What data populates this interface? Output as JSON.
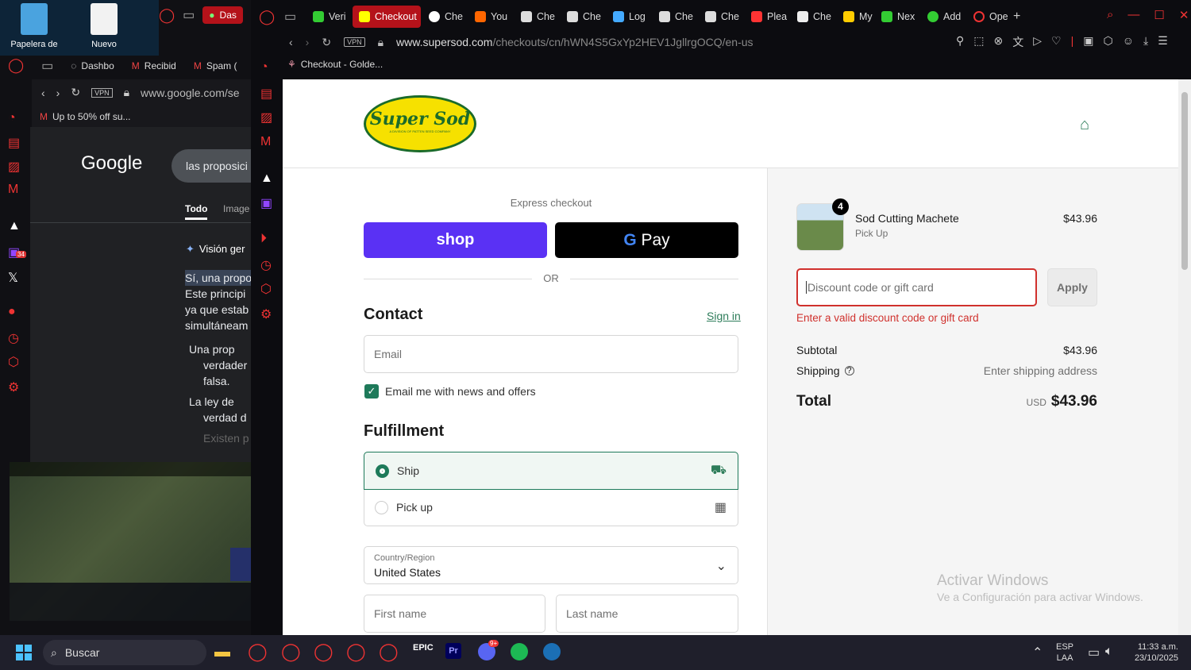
{
  "desktop": {
    "icons": [
      {
        "label": "Papelera de"
      },
      {
        "label": "Nuevo"
      }
    ]
  },
  "back_browser": {
    "tabs": [
      {
        "label": "Das"
      }
    ],
    "bookmarks": [
      {
        "label": "Dashbo"
      },
      {
        "label": "Recibid"
      },
      {
        "label": "Spam ("
      }
    ],
    "url": "www.google.com/se",
    "bookmark_bar": "Up to 50% off su...",
    "google_logo": "Google",
    "search_text": "las proposici",
    "tab_all": "Todo",
    "tab_images": "Image",
    "ai_title": "Visión ger",
    "lines": [
      "Sí, una propo",
      "Este principi",
      "ya que estab",
      "simultáneam"
    ],
    "bullets": [
      "Una prop",
      "verdader",
      "falsa.",
      "La ley de",
      "verdad d",
      "Existen p"
    ],
    "badge": "34"
  },
  "front_browser": {
    "tabs": [
      {
        "label": "Veri"
      },
      {
        "label": "Checkout",
        "active": true
      },
      {
        "label": "Che"
      },
      {
        "label": "You"
      },
      {
        "label": "Che"
      },
      {
        "label": "Che"
      },
      {
        "label": "Log"
      },
      {
        "label": "Che"
      },
      {
        "label": "Che"
      },
      {
        "label": "Plea"
      },
      {
        "label": "Che"
      },
      {
        "label": "My"
      },
      {
        "label": "Nex"
      },
      {
        "label": "Add"
      },
      {
        "label": "Ope"
      }
    ],
    "url_host": "www.supersod.com",
    "url_path": "/checkouts/cn/hWN4S5GxYp2HEV1JgllrgOCQ/en-us",
    "vpn": "VPN",
    "bookmark": "Checkout - Golde..."
  },
  "checkout": {
    "logo_text": "Super Sod",
    "logo_sub": "A DIVISION OF PATTEN SEED COMPANY",
    "express": "Express checkout",
    "shop": "shop",
    "gpay": "Pay",
    "or": "OR",
    "contact": "Contact",
    "signin": "Sign in",
    "email_placeholder": "Email",
    "news": "Email me with news and offers",
    "fulfillment": "Fulfillment",
    "ship": "Ship",
    "pickup": "Pick up",
    "country_label": "Country/Region",
    "country": "United States",
    "first_name": "First name",
    "last_name": "Last name",
    "item": {
      "name": "Sod Cutting Machete",
      "sub": "Pick Up",
      "price": "$43.96",
      "qty": "4"
    },
    "discount_placeholder": "Discount code or gift card",
    "apply": "Apply",
    "error": "Enter a valid discount code or gift card",
    "subtotal_label": "Subtotal",
    "subtotal": "$43.96",
    "shipping_label": "Shipping",
    "shipping": "Enter shipping address",
    "total_label": "Total",
    "currency": "USD",
    "total": "$43.96",
    "watermark1": "Activar Windows",
    "watermark2": "Ve a Configuración para activar Windows."
  },
  "taskbar": {
    "search": "Buscar",
    "lang1": "ESP",
    "lang2": "LAA",
    "time": "11:33 a.m.",
    "date": "23/10/2025",
    "discord_badge": "9+"
  },
  "colors": {
    "accent": "#e33",
    "shop": "#5a31f4",
    "error": "#d0312d",
    "check": "#1e7a5a"
  }
}
